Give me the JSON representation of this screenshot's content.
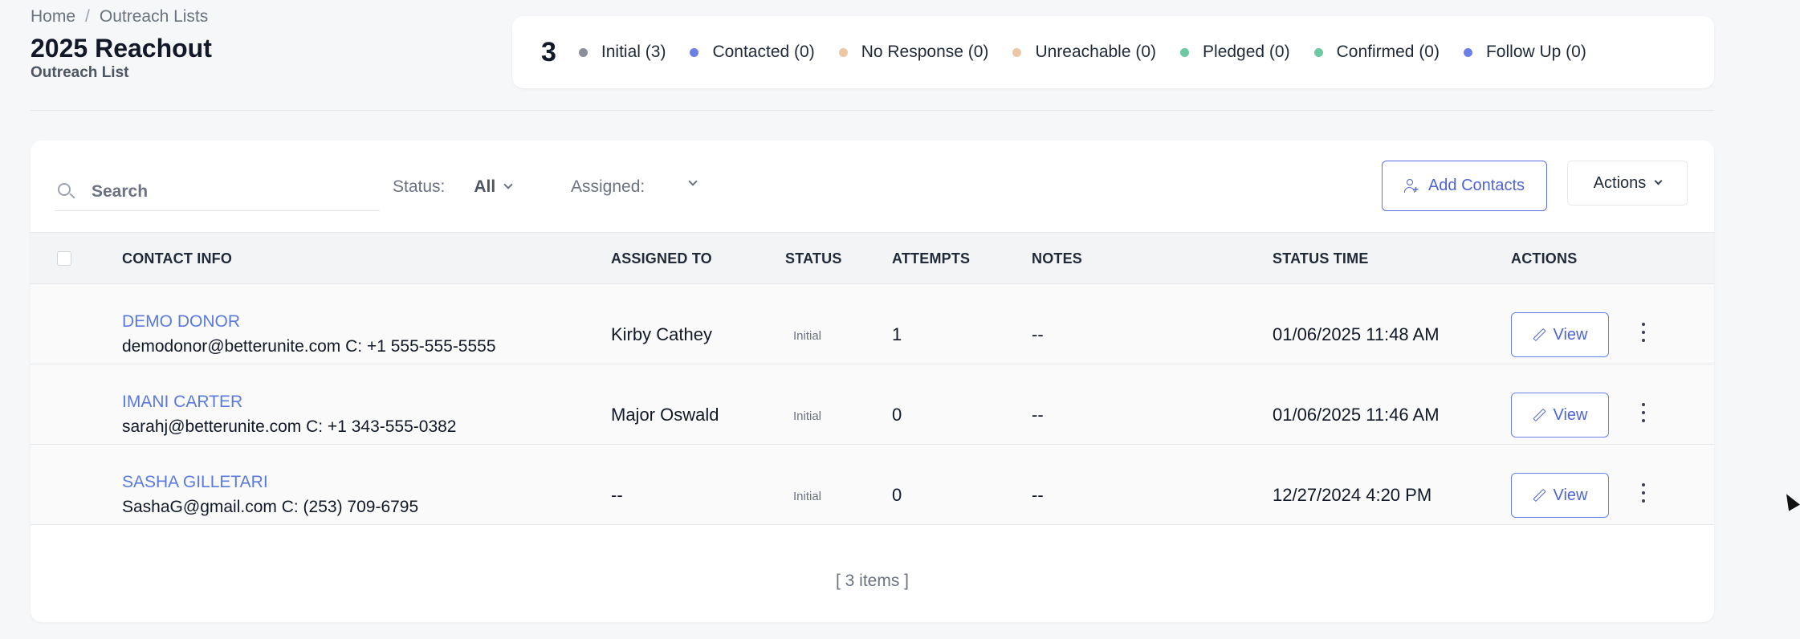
{
  "breadcrumb": {
    "home": "Home",
    "separator": "/",
    "current": "Outreach Lists"
  },
  "page": {
    "title": "2025 Reachout",
    "subtitle": "Outreach List"
  },
  "summary": {
    "total": "3",
    "legend": [
      {
        "label": "Initial (3)",
        "color": "#8b8f9c"
      },
      {
        "label": "Contacted (0)",
        "color": "#6b80e6"
      },
      {
        "label": "No Response (0)",
        "color": "#ecc7a3"
      },
      {
        "label": "Unreachable (0)",
        "color": "#ecc7a3"
      },
      {
        "label": "Pledged (0)",
        "color": "#6cc9a3"
      },
      {
        "label": "Confirmed (0)",
        "color": "#6cc9a3"
      },
      {
        "label": "Follow Up (0)",
        "color": "#6b80e6"
      }
    ]
  },
  "toolbar": {
    "search_placeholder": "Search",
    "status_label": "Status:",
    "status_value": "All",
    "assigned_label": "Assigned:",
    "assigned_value": "",
    "add_contacts_label": "Add Contacts",
    "actions_label": "Actions"
  },
  "table": {
    "headers": {
      "contact_info": "CONTACT INFO",
      "assigned_to": "ASSIGNED TO",
      "status": "STATUS",
      "attempts": "ATTEMPTS",
      "notes": "NOTES",
      "status_time": "STATUS TIME",
      "actions": "ACTIONS"
    },
    "rows": [
      {
        "name": "DEMO DONOR",
        "detail": "demodonor@betterunite.com C: +1 555-555-5555",
        "assigned_to": "Kirby Cathey",
        "status": "Initial",
        "attempts": "1",
        "notes": "--",
        "status_time": "01/06/2025 11:48 AM",
        "action": "View"
      },
      {
        "name": "IMANI CARTER",
        "detail": "sarahj@betterunite.com C: +1 343-555-0382",
        "assigned_to": "Major Oswald",
        "status": "Initial",
        "attempts": "0",
        "notes": "--",
        "status_time": "01/06/2025 11:46 AM",
        "action": "View"
      },
      {
        "name": "SASHA GILLETARI",
        "detail": "SashaG@gmail.com C: (253) 709-6795",
        "assigned_to": "--",
        "status": "Initial",
        "attempts": "0",
        "notes": "--",
        "status_time": "12/27/2024 4:20 PM",
        "action": "View"
      }
    ],
    "footer": "[ 3 items ]"
  }
}
